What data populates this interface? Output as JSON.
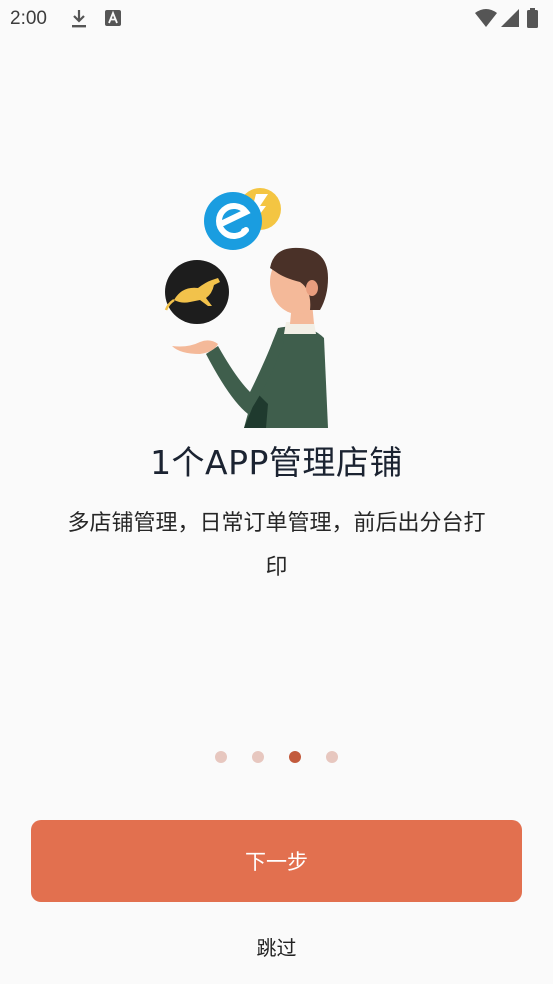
{
  "status_bar": {
    "time": "2:00",
    "icons": [
      "download-icon",
      "a-notification-icon",
      "wifi-icon",
      "signal-icon",
      "battery-icon"
    ]
  },
  "illustration": {
    "icons": [
      "eleme-logo-icon",
      "yellow-bolt-icon",
      "kangaroo-logo-icon",
      "person-illustration"
    ]
  },
  "onboarding": {
    "title": "1个APP管理店铺",
    "subtitle": "多店铺管理，日常订单管理，前后出分台打印",
    "pages": 4,
    "current_page": 3
  },
  "actions": {
    "next_label": "下一步",
    "skip_label": "跳过"
  },
  "colors": {
    "accent": "#e2704f",
    "dot_active": "#c25a3c",
    "dot_inactive": "#e7c7bf",
    "background": "#fafafa",
    "title": "#1b2331"
  }
}
